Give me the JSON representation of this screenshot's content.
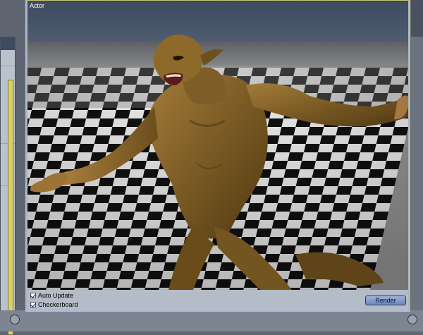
{
  "window": {
    "title": "Actor"
  },
  "preview": {
    "subject": "figure-render"
  },
  "controls": {
    "auto_update_label": "Auto Update",
    "auto_update_checked": true,
    "checkerboard_label": "Checkerboard",
    "checkerboard_checked": true,
    "render_button_label": "Render"
  },
  "colors": {
    "window_title_bg": "#3f4a5c",
    "accent_border": "#c8c870",
    "button": "#7f98c8"
  }
}
